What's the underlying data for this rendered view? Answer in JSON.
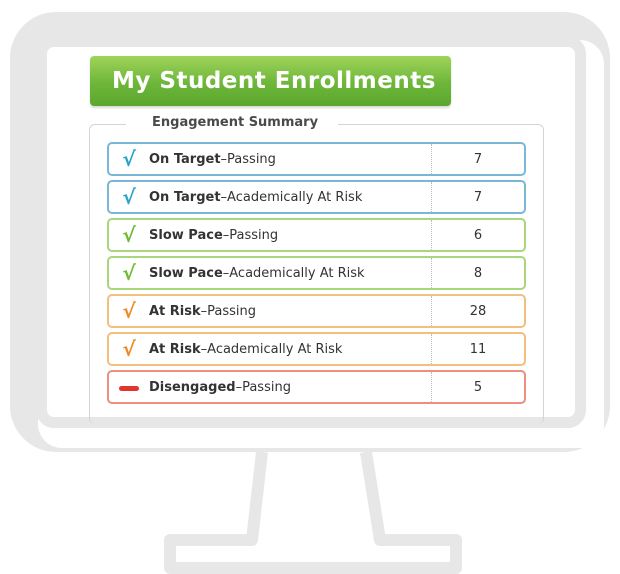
{
  "header": {
    "title": "My Student Enrollments"
  },
  "summary": {
    "title": "Engagement Summary",
    "rows": [
      {
        "category": "On Target",
        "status": "Passing",
        "count": "7",
        "icon": "check-icon",
        "color": "#2aa3c9",
        "border": "#7ab6d6"
      },
      {
        "category": "On Target",
        "status": "Academically At Risk",
        "count": "7",
        "icon": "check-icon",
        "color": "#2aa3c9",
        "border": "#7ab6d6"
      },
      {
        "category": "Slow Pace",
        "status": "Passing",
        "count": "6",
        "icon": "check-icon",
        "color": "#6dbb2f",
        "border": "#a9d67a"
      },
      {
        "category": "Slow Pace",
        "status": "Academically At Risk",
        "count": "8",
        "icon": "check-icon",
        "color": "#6dbb2f",
        "border": "#a9d67a"
      },
      {
        "category": "At Risk",
        "status": "Passing",
        "count": "28",
        "icon": "check-icon",
        "color": "#f08a24",
        "border": "#f3bf7f"
      },
      {
        "category": "At Risk",
        "status": "Academically At Risk",
        "count": "11",
        "icon": "check-icon",
        "color": "#f08a24",
        "border": "#f3bf7f"
      },
      {
        "category": "Disengaged",
        "status": "Passing",
        "count": "5",
        "icon": "dash-icon",
        "color": "#e0362c",
        "border": "#ec8f7e"
      }
    ]
  }
}
